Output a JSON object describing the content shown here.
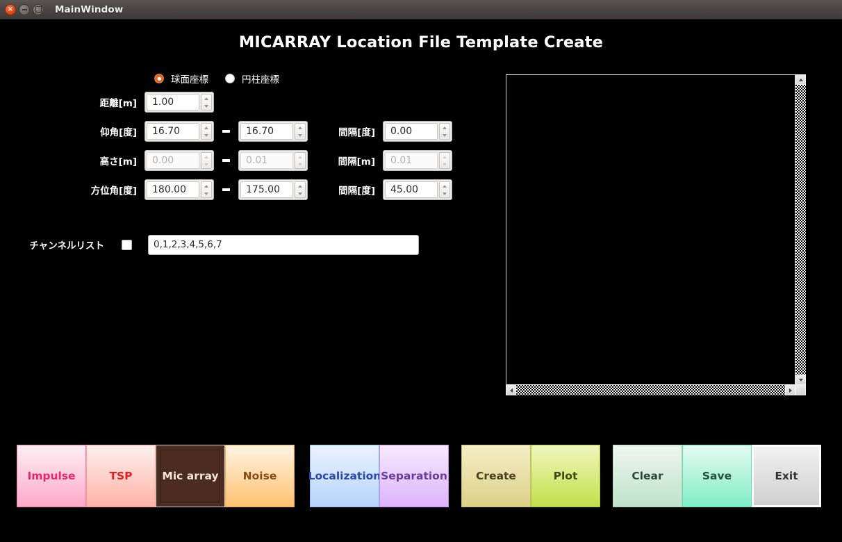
{
  "window": {
    "title": "MainWindow",
    "close_glyph": "×",
    "buttons": {
      "close": "close-button",
      "minimize": "minimize-button",
      "maximize": "maximize-button"
    }
  },
  "page_title": "MICARRAY Location File Template Create",
  "coordinate_modes": [
    {
      "label": "球面座標",
      "selected": true
    },
    {
      "label": "円柱座標",
      "selected": false
    }
  ],
  "form": {
    "separator": "-",
    "rows": [
      {
        "label": "距離[m]",
        "start": "1.00",
        "disabled": false,
        "has_range": false,
        "has_step": false
      },
      {
        "label": "仰角[度]",
        "start": "16.70",
        "end": "16.70",
        "disabled": false,
        "has_range": true,
        "has_step": true,
        "step_label": "間隔[度]",
        "step": "0.00"
      },
      {
        "label": "高さ[m]",
        "start": "0.00",
        "end": "0.01",
        "disabled": true,
        "has_range": true,
        "has_step": true,
        "step_label": "間隔[m]",
        "step": "0.01"
      },
      {
        "label": "方位角[度]",
        "start": "180.00",
        "end": "175.00",
        "disabled": false,
        "has_range": true,
        "has_step": true,
        "step_label": "間隔[度]",
        "step": "45.00"
      }
    ],
    "channel_list": {
      "label": "チャンネルリスト",
      "checked": false,
      "value": "0,1,2,3,4,5,6,7"
    }
  },
  "plot": {
    "background_color": "#000000",
    "border_color": "#d6d4d2",
    "scrollbars": {
      "vertical": true,
      "horizontal": true
    }
  },
  "button_groups": [
    {
      "name": "mode-group",
      "buttons": [
        {
          "label": "Impulse",
          "bg_top": "#fdeff4",
          "bg_bottom": "#ffa9c9",
          "border": "#ff7fb0",
          "text_color": "#e8276f",
          "selected": false,
          "focused": false
        },
        {
          "label": "TSP",
          "bg_top": "#fdf0ee",
          "bg_bottom": "#ffb3a8",
          "border": "#ff9f92",
          "text_color": "#e02020",
          "selected": false,
          "focused": false
        },
        {
          "label": "Mic array",
          "bg_top": "#4c2b20",
          "bg_bottom": "#4c2b20",
          "border": "#d8cfc9",
          "text_color": "#f0e4d8",
          "selected": true,
          "focused": false
        },
        {
          "label": "Noise",
          "bg_top": "#fff4e2",
          "bg_bottom": "#ffc271",
          "border": "#f7a94f",
          "text_color": "#8a4a12",
          "selected": false,
          "focused": false
        }
      ]
    },
    {
      "name": "process-group",
      "buttons": [
        {
          "label": "Localization",
          "bg_top": "#eaf3ff",
          "bg_bottom": "#b6d4fb",
          "border": "#8fbdf5",
          "text_color": "#2a49a8",
          "selected": false,
          "focused": false
        },
        {
          "label": "Separation",
          "bg_top": "#f7eaff",
          "bg_bottom": "#ddb4fb",
          "border": "#c78ff0",
          "text_color": "#6a3b9e",
          "selected": false,
          "focused": false
        }
      ]
    },
    {
      "name": "action-group",
      "buttons": [
        {
          "label": "Create",
          "bg_top": "#f4eec7",
          "bg_bottom": "#ddd188",
          "border": "#c9bd6e",
          "text_color": "#4a4020",
          "selected": false,
          "focused": false
        },
        {
          "label": "Plot",
          "bg_top": "#f1f6bd",
          "bg_bottom": "#c3e04a",
          "border": "#aac93a",
          "text_color": "#3c4a12",
          "selected": false,
          "focused": false
        }
      ]
    },
    {
      "name": "file-group",
      "buttons": [
        {
          "label": "Clear",
          "bg_top": "#eef7ef",
          "bg_bottom": "#bfe3ca",
          "border": "#a8d7bb",
          "text_color": "#2c4a38",
          "selected": false,
          "focused": false
        },
        {
          "label": "Save",
          "bg_top": "#e6fbf2",
          "bg_bottom": "#7fedc7",
          "border": "#62dfb4",
          "text_color": "#23503f",
          "selected": false,
          "focused": false
        },
        {
          "label": "Exit",
          "bg_top": "#f2f2f2",
          "bg_bottom": "#cfcfcf",
          "border": "#ffffff",
          "text_color": "#333333",
          "selected": false,
          "focused": true
        }
      ]
    }
  ]
}
